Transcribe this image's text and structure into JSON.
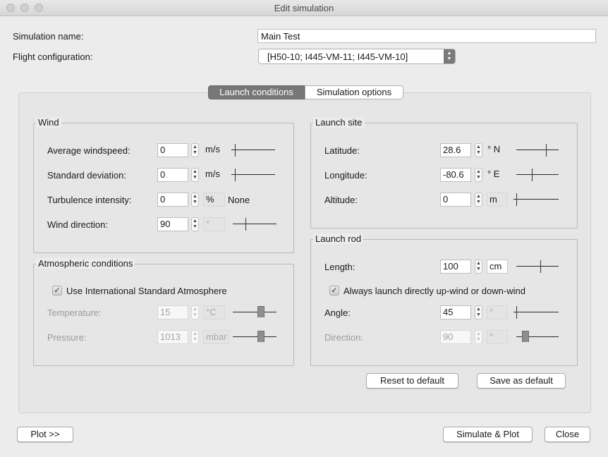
{
  "window": {
    "title": "Edit simulation"
  },
  "header": {
    "name_label": "Simulation name:",
    "name_value": "Main Test",
    "config_label": "Flight configuration:",
    "config_value": "[H50-10; I445-VM-11; I445-VM-10]"
  },
  "tabs": [
    {
      "label": "Launch conditions",
      "active": true
    },
    {
      "label": "Simulation options",
      "active": false
    }
  ],
  "wind": {
    "title": "Wind",
    "rows": [
      {
        "label": "Average windspeed:",
        "value": "0",
        "unit": "m/s",
        "extra": ""
      },
      {
        "label": "Standard deviation:",
        "value": "0",
        "unit": "m/s",
        "extra": ""
      },
      {
        "label": "Turbulence intensity:",
        "value": "0",
        "unit": "%",
        "extra": "None"
      },
      {
        "label": "Wind direction:",
        "value": "90",
        "unit": "°",
        "extra": ""
      }
    ]
  },
  "atmosphere": {
    "title": "Atmospheric conditions",
    "checkbox_label": "Use International Standard Atmosphere",
    "checked": true,
    "rows": [
      {
        "label": "Temperature:",
        "value": "15",
        "unit": "°C"
      },
      {
        "label": "Pressure:",
        "value": "1013",
        "unit": "mbar"
      }
    ]
  },
  "launch_site": {
    "title": "Launch site",
    "rows": [
      {
        "label": "Latitude:",
        "value": "28.6",
        "unit": "° N"
      },
      {
        "label": "Longitude:",
        "value": "-80.6",
        "unit": "° E"
      },
      {
        "label": "Altitude:",
        "value": "0",
        "unit": "m"
      }
    ]
  },
  "launch_rod": {
    "title": "Launch rod",
    "checkbox_label": "Always launch directly up-wind or down-wind",
    "checked": true,
    "rows": [
      {
        "label": "Length:",
        "value": "100",
        "unit": "cm"
      },
      {
        "label": "Angle:",
        "value": "45",
        "unit": "°"
      },
      {
        "label": "Direction:",
        "value": "90",
        "unit": "°"
      }
    ]
  },
  "buttons": {
    "reset": "Reset to default",
    "save_default": "Save as default",
    "plot": "Plot >>",
    "simulate_plot": "Simulate & Plot",
    "close": "Close"
  }
}
